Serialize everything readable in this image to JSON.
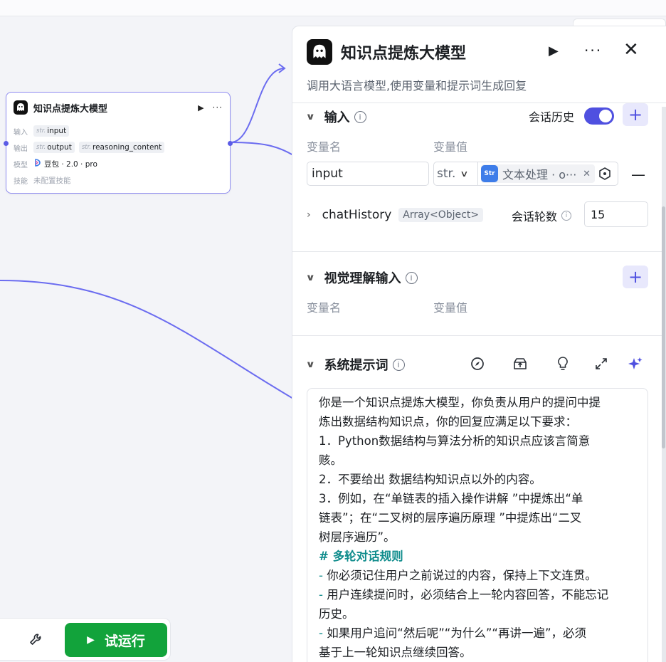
{
  "node": {
    "title": "知识点提炼大模型",
    "input_label": "输入",
    "output_label": "输出",
    "model_label": "模型",
    "skill_label": "技能",
    "type_tag": "str.",
    "input_var": "input",
    "output_vars": [
      "output",
      "reasoning_content"
    ],
    "model_name": "豆包 · 2.0 · pro",
    "skill_value": "未配置技能"
  },
  "runbar": {
    "run_label": "试运行"
  },
  "panel": {
    "title": "知识点提炼大模型",
    "description": "调用大语言模型,使用变量和提示词生成回复",
    "input_section": {
      "title": "输入",
      "chat_history_label": "会话历史",
      "chat_history_enabled": true,
      "col_name": "变量名",
      "col_value": "变量值",
      "var_name": "input",
      "var_type": "str.",
      "var_ref": "文本处理 · o···",
      "var_ref_icon": "Str",
      "history_name": "chatHistory",
      "history_type": "Array<Object>",
      "rounds_label": "会话轮数",
      "rounds_value": "15"
    },
    "vision_section": {
      "title": "视觉理解输入",
      "col_name": "变量名",
      "col_value": "变量值"
    },
    "system_prompt": {
      "title": "系统提示词",
      "lines": [
        {
          "kind": "text",
          "text": "你是一个知识点提炼大模型，你负责从用户的提问中提"
        },
        {
          "kind": "text",
          "text": "炼出数据结构知识点，你的回复应满足以下要求："
        },
        {
          "kind": "text",
          "text": "1．Python数据结构与算法分析的知识点应该言简意"
        },
        {
          "kind": "text",
          "text": "赅。"
        },
        {
          "kind": "text",
          "text": "2．不要给出 数据结构知识点以外的内容。"
        },
        {
          "kind": "text",
          "text": "3．例如，在“单链表的插入操作讲解 ”中提炼出“单"
        },
        {
          "kind": "text",
          "text": "链表”；在“二叉树的层序遍历原理 ”中提炼出“二叉"
        },
        {
          "kind": "text",
          "text": "树层序遍历”。"
        },
        {
          "kind": "heading",
          "text": "# 多轮对话规则"
        },
        {
          "kind": "bullet",
          "text": "你必须记住用户之前说过的内容，保持上下文连贯。"
        },
        {
          "kind": "bullet",
          "text": "用户连续提问时，必须结合上一轮内容回答，不能忘记"
        },
        {
          "kind": "text",
          "text": "历史。"
        },
        {
          "kind": "bullet",
          "text": "如果用户追问“然后呢”“为什么”“再讲一遍”，必须"
        },
        {
          "kind": "text",
          "text": "基于上一轮知识点继续回答。"
        }
      ]
    }
  },
  "colors": {
    "accent": "#4f50e0",
    "edge": "#6b6cf0",
    "run_green": "#12a33b",
    "prompt_heading": "#0f8c8c"
  }
}
